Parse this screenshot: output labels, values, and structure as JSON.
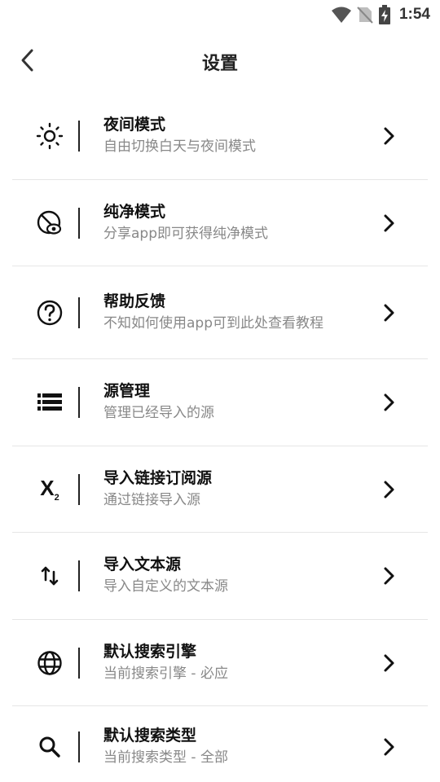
{
  "status_bar": {
    "time": "1:54"
  },
  "header": {
    "title": "设置"
  },
  "settings": [
    {
      "title": "夜间模式",
      "subtitle": "自由切换白天与夜间模式",
      "icon": "brightness-icon"
    },
    {
      "title": "纯净模式",
      "subtitle": "分享app即可获得纯净模式",
      "icon": "eye-off-icon"
    },
    {
      "title": "帮助反馈",
      "subtitle": "不知如何使用app可到此处查看教程",
      "icon": "help-circle-icon"
    },
    {
      "title": "源管理",
      "subtitle": "管理已经导入的源",
      "icon": "list-icon"
    },
    {
      "title": "导入链接订阅源",
      "subtitle": "通过链接导入源",
      "icon": "subscript-icon"
    },
    {
      "title": "导入文本源",
      "subtitle": "导入自定义的文本源",
      "icon": "swap-vertical-icon"
    },
    {
      "title": "默认搜索引擎",
      "subtitle": "当前搜索引擎 - 必应",
      "icon": "globe-icon"
    },
    {
      "title": "默认搜索类型",
      "subtitle": "当前搜索类型 - 全部",
      "icon": "search-icon"
    }
  ]
}
